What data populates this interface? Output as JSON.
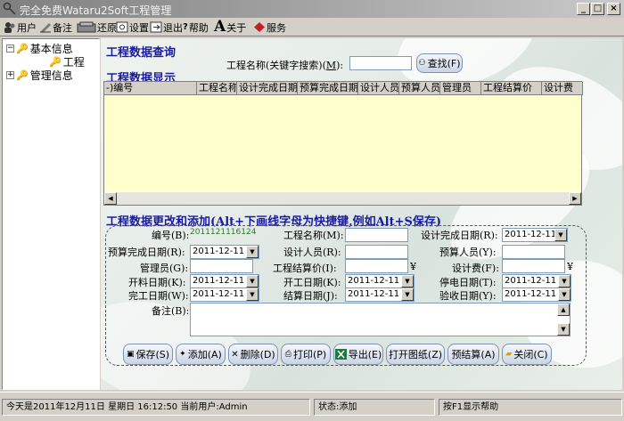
{
  "window": {
    "title": "完全免费Wataru2Soft工程管理",
    "controls": [
      "_",
      "□",
      "×"
    ]
  },
  "toolbar": {
    "items": [
      {
        "label": "用户",
        "icon": "users-icon"
      },
      {
        "label": "备注",
        "icon": "note-icon"
      },
      {
        "label": "还原",
        "icon": "restore-icon"
      },
      {
        "label": "设置",
        "icon": "settings-icon"
      },
      {
        "label": "退出",
        "icon": "exit-icon"
      },
      {
        "label": "帮助",
        "icon": "help-icon"
      },
      {
        "label": "关于",
        "icon": "font-icon"
      },
      {
        "label": "服务",
        "icon": "service-icon"
      }
    ]
  },
  "tree": {
    "items": [
      {
        "label": "基本信息",
        "expander": "−"
      },
      {
        "label": "工程",
        "expander": ""
      },
      {
        "label": "管理信息",
        "expander": "+"
      }
    ]
  },
  "query": {
    "title": "工程数据查询",
    "search_label": "工程名称(关键字搜索)(",
    "search_hotkey": "M",
    "search_label_end": "):",
    "search_value": "",
    "search_button": "查找(F)"
  },
  "grid": {
    "title": "工程数据显示",
    "row_marker": "-)",
    "columns": [
      "编号",
      "工程名称",
      "设计完成日期",
      "预算完成日期",
      "设计人员",
      "预算人员",
      "管理员",
      "工程结算价",
      "设计费"
    ]
  },
  "edit": {
    "title": "工程数据更改和添加(Alt+下画线字母为快捷键,例如Alt+S保存)",
    "fields": {
      "code_label": "编号(B):",
      "code_value": "2011121116124",
      "name_label": "工程名称(M):",
      "design_done_label": "设计完成日期(R):",
      "design_done_value": "2011-12-11",
      "budget_done_label": "预算完成日期(R):",
      "budget_done_value": "2011-12-11",
      "designer_label": "设计人员(R):",
      "budgeter_label": "预算人员(Y):",
      "manager_label": "管理员(G):",
      "settle_price_label": "工程结算价(I):",
      "currency": "¥",
      "design_fee_label": "设计费(F):",
      "open_date_label": "开料日期(K):",
      "open_date_value": "2011-12-11",
      "start_date_label": "开工日期(K):",
      "start_date_value": "2011-12-11",
      "power_date_label": "停电日期(T):",
      "power_date_value": "2011-12-11",
      "finish_date_label": "完工日期(W):",
      "finish_date_value": "2011-12-11",
      "settle_date_label": "结算日期(J):",
      "settle_date_value": "2011-12-11",
      "accept_date_label": "验收日期(Y):",
      "accept_date_value": "2011-12-11",
      "remark_label": "备注(B):"
    },
    "buttons": [
      {
        "label": "保存(S)",
        "icon": "save-icon"
      },
      {
        "label": "添加(A)",
        "icon": "add-icon"
      },
      {
        "label": "删除(D)",
        "icon": "delete-icon"
      },
      {
        "label": "打印(P)",
        "icon": "print-icon"
      },
      {
        "label": "导出(E)",
        "icon": "excel-icon"
      },
      {
        "label": "打开图纸(Z)",
        "icon": ""
      },
      {
        "label": "预结算(A)",
        "icon": ""
      },
      {
        "label": "关闭(C)",
        "icon": "folder-icon"
      }
    ]
  },
  "status": {
    "datetime": "今天是2011年12月11日 星期日 16:12:50",
    "user": "当前用户:Admin",
    "state": "状态:添加",
    "hint": "按F1显示帮助"
  },
  "colors": {
    "title_text": "#1a1aa0",
    "grid_bg": "#ffffcc",
    "date_text": "#2a7a2a"
  }
}
